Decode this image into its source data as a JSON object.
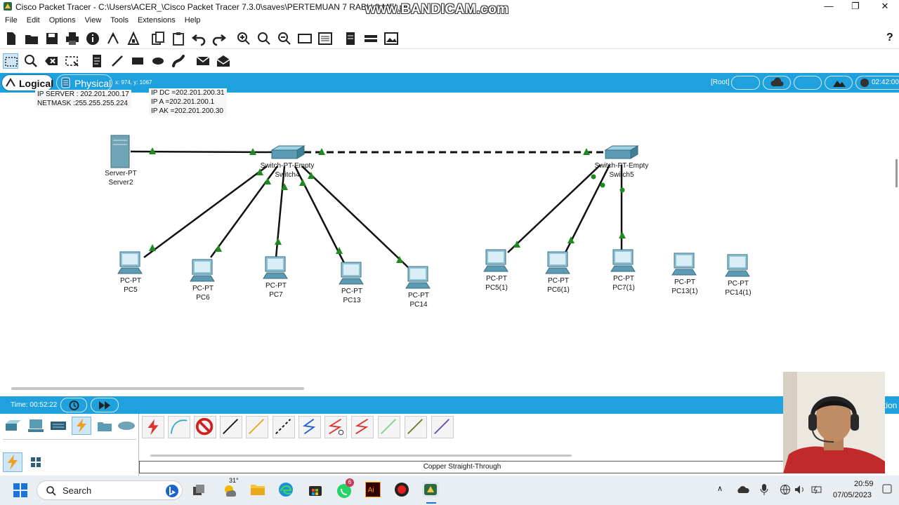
{
  "window": {
    "title": "Cisco Packet Tracer - C:\\Users\\ACER_\\Cisco Packet Tracer 7.3.0\\saves\\PERTEMUAN 7 RABU 3 MEI.pkt",
    "watermark": "www.BANDICAM.com",
    "minimize": "—",
    "maximize": "❐",
    "close": "✕"
  },
  "menu": [
    "File",
    "Edit",
    "Options",
    "View",
    "Tools",
    "Extensions",
    "Help"
  ],
  "toolbar_help": "?",
  "workspace": {
    "logical_tab": "Logical",
    "physical_tab": "Physical",
    "coords": "x: 974, y: 1067",
    "root_label": "[Root]",
    "clock": "02:42:00"
  },
  "notes": {
    "server_note": [
      "IP SERVER : 202.201.200.17",
      "NETMASK :255.255.255.224"
    ],
    "ip_note": [
      "IP DC =202.201.200.31",
      "IP A =202.201.200.1",
      "IP AK =202.201.200.30"
    ]
  },
  "devices": {
    "server2": {
      "type": "Server-PT",
      "name": "Server2"
    },
    "switch4": {
      "type": "Switch-PT-Empty",
      "name": "Switch4"
    },
    "switch5": {
      "type": "Switch-PT-Empty",
      "name": "Switch5"
    },
    "pc5": {
      "type": "PC-PT",
      "name": "PC5"
    },
    "pc6": {
      "type": "PC-PT",
      "name": "PC6"
    },
    "pc7": {
      "type": "PC-PT",
      "name": "PC7"
    },
    "pc13": {
      "type": "PC-PT",
      "name": "PC13"
    },
    "pc14": {
      "type": "PC-PT",
      "name": "PC14"
    },
    "pc5_1": {
      "type": "PC-PT",
      "name": "PC5(1)"
    },
    "pc6_1": {
      "type": "PC-PT",
      "name": "PC6(1)"
    },
    "pc7_1": {
      "type": "PC-PT",
      "name": "PC7(1)"
    },
    "pc13_1": {
      "type": "PC-PT",
      "name": "PC13(1)"
    },
    "pc14_1": {
      "type": "PC-PT",
      "name": "PC14(1)"
    }
  },
  "bottom": {
    "time": "Time: 00:52:22",
    "simulation_partial": "tion",
    "selected_cable": "Copper Straight-Through"
  },
  "taskbar": {
    "search": "Search",
    "weather": "31°",
    "whatsapp_badge": "6",
    "time": "20:59",
    "date": "07/05/2023"
  },
  "colors": {
    "accent": "#1ea1dc",
    "link_green": "#1f8a1f"
  }
}
